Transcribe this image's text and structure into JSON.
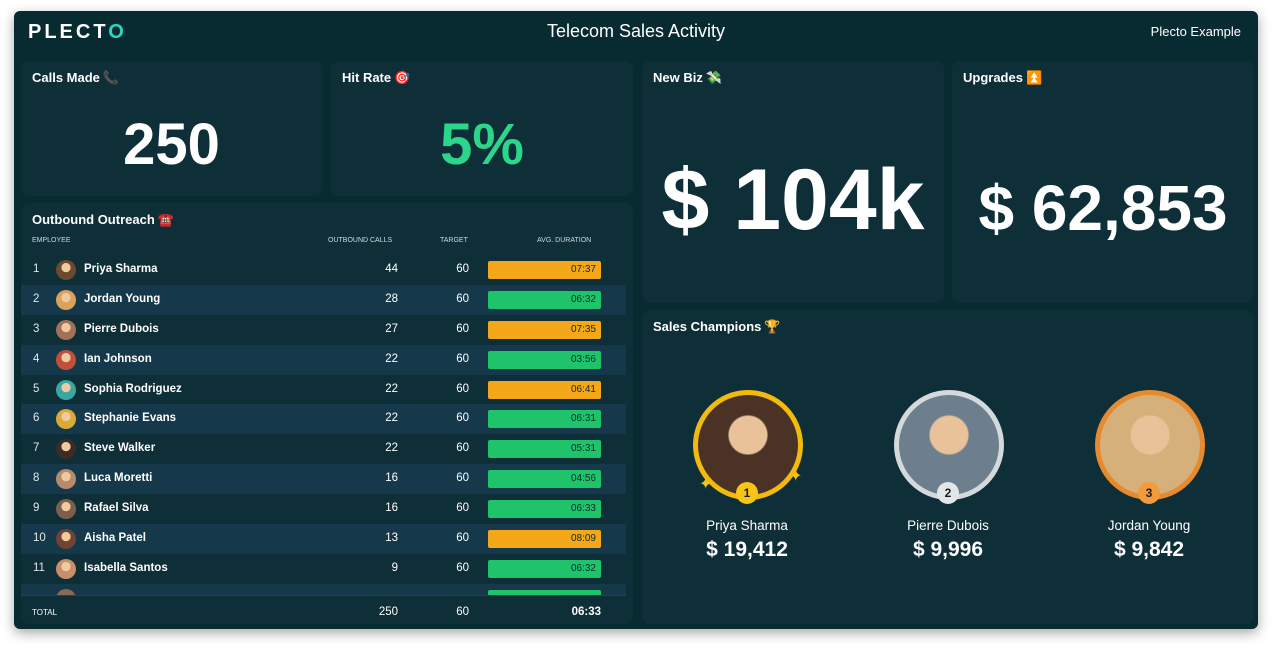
{
  "header": {
    "logo_text": "PLECT",
    "logo_accent": "O",
    "title": "Telecom Sales Activity",
    "account": "Plecto Example"
  },
  "calls_made": {
    "title": "Calls Made",
    "emoji": "📞",
    "value": "250"
  },
  "hit_rate": {
    "title": "Hit Rate",
    "emoji": "🎯",
    "value": "5%"
  },
  "new_biz": {
    "title": "New Biz",
    "emoji": "💸",
    "value": "$ 104k"
  },
  "upgrades": {
    "title": "Upgrades",
    "emoji": "⏫",
    "value": "$ 62,853"
  },
  "outreach": {
    "title": "Outbound Outreach",
    "emoji": "☎️",
    "columns": {
      "employee": "EMPLOYEE",
      "calls": "OUTBOUND CALLS",
      "target": "TARGET",
      "duration": "AVG. DURATION"
    },
    "rows": [
      {
        "rank": "1",
        "name": "Priya Sharma",
        "calls": "44",
        "target": "60",
        "duration": "07:37",
        "status": "orange",
        "avatar": "#6b4a2f"
      },
      {
        "rank": "2",
        "name": "Jordan Young",
        "calls": "28",
        "target": "60",
        "duration": "06:32",
        "status": "green",
        "avatar": "#d9a35c"
      },
      {
        "rank": "3",
        "name": "Pierre Dubois",
        "calls": "27",
        "target": "60",
        "duration": "07:35",
        "status": "orange",
        "avatar": "#a07258"
      },
      {
        "rank": "4",
        "name": "Ian Johnson",
        "calls": "22",
        "target": "60",
        "duration": "03:56",
        "status": "green",
        "avatar": "#c0503a"
      },
      {
        "rank": "5",
        "name": "Sophia Rodriguez",
        "calls": "22",
        "target": "60",
        "duration": "06:41",
        "status": "orange",
        "avatar": "#3aa7a0"
      },
      {
        "rank": "6",
        "name": "Stephanie Evans",
        "calls": "22",
        "target": "60",
        "duration": "06:31",
        "status": "green",
        "avatar": "#d9a93a"
      },
      {
        "rank": "7",
        "name": "Steve Walker",
        "calls": "22",
        "target": "60",
        "duration": "05:31",
        "status": "green",
        "avatar": "#3b2c25"
      },
      {
        "rank": "8",
        "name": "Luca Moretti",
        "calls": "16",
        "target": "60",
        "duration": "04:56",
        "status": "green",
        "avatar": "#b88a6c"
      },
      {
        "rank": "9",
        "name": "Rafael Silva",
        "calls": "16",
        "target": "60",
        "duration": "06:33",
        "status": "green",
        "avatar": "#7d5f4c"
      },
      {
        "rank": "10",
        "name": "Aisha Patel",
        "calls": "13",
        "target": "60",
        "duration": "08:09",
        "status": "orange",
        "avatar": "#6e4433"
      },
      {
        "rank": "11",
        "name": "Isabella Santos",
        "calls": "9",
        "target": "60",
        "duration": "06:32",
        "status": "green",
        "avatar": "#c8906a"
      }
    ],
    "footer": {
      "label": "TOTAL",
      "calls": "250",
      "target": "60",
      "duration": "06:33"
    }
  },
  "champions": {
    "title": "Sales Champions",
    "emoji": "🏆",
    "items": [
      {
        "rank": "1",
        "name": "Priya Sharma",
        "amount": "$ 19,412",
        "ring": "#f2b90f",
        "badge": "#f5c518",
        "photo": "#4a3324"
      },
      {
        "rank": "2",
        "name": "Pierre Dubois",
        "amount": "$ 9,996",
        "ring": "#d4d9dc",
        "badge": "#e3e6e8",
        "photo": "#6d7f8c"
      },
      {
        "rank": "3",
        "name": "Jordan Young",
        "amount": "$ 9,842",
        "ring": "#e58a2e",
        "badge": "#f29a3c",
        "photo": "#d6b07a"
      }
    ]
  },
  "colors": {
    "background": "#082a31",
    "card": "#0e2e38",
    "accent_green": "#2bd58a",
    "pill_orange": "#f5a71a",
    "pill_green": "#1fc46a"
  }
}
